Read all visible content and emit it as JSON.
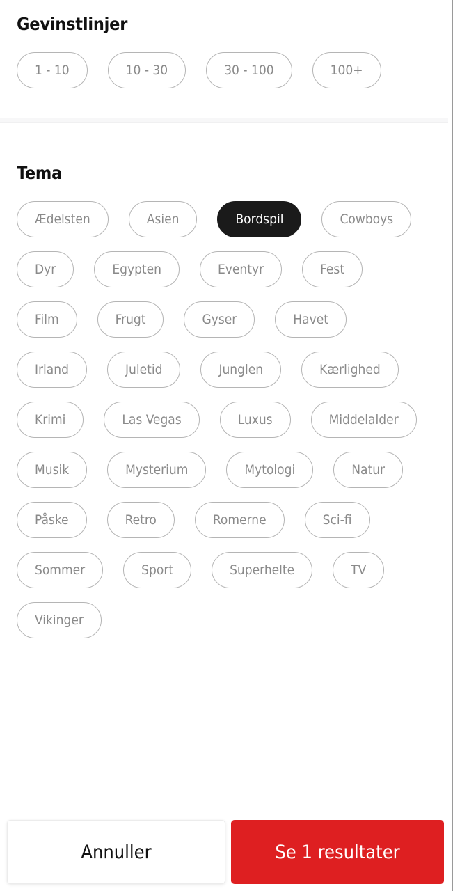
{
  "screen": {
    "name": "filter-panel",
    "accent_color": "#de1f21",
    "selected_chip_color": "#1a1a1a",
    "chip_border_color": "#b5b5b5",
    "chip_text_color": "#8a8a8a"
  },
  "sections": [
    {
      "id": "gevinstlinjer",
      "title": "Gevinstlinjer",
      "chips": [
        {
          "label": "1 - 10",
          "selected": false
        },
        {
          "label": "10 - 30",
          "selected": false
        },
        {
          "label": "30 - 100",
          "selected": false
        },
        {
          "label": "100+",
          "selected": false
        }
      ]
    },
    {
      "id": "tema",
      "title": "Tema",
      "chips": [
        {
          "label": "Ædelsten",
          "selected": false
        },
        {
          "label": "Asien",
          "selected": false
        },
        {
          "label": "Bordspil",
          "selected": true
        },
        {
          "label": "Cowboys",
          "selected": false
        },
        {
          "label": "Dyr",
          "selected": false
        },
        {
          "label": "Egypten",
          "selected": false
        },
        {
          "label": "Eventyr",
          "selected": false
        },
        {
          "label": "Fest",
          "selected": false
        },
        {
          "label": "Film",
          "selected": false
        },
        {
          "label": "Frugt",
          "selected": false
        },
        {
          "label": "Gyser",
          "selected": false
        },
        {
          "label": "Havet",
          "selected": false
        },
        {
          "label": "Irland",
          "selected": false
        },
        {
          "label": "Juletid",
          "selected": false
        },
        {
          "label": "Junglen",
          "selected": false
        },
        {
          "label": "Kærlighed",
          "selected": false
        },
        {
          "label": "Krimi",
          "selected": false
        },
        {
          "label": "Las Vegas",
          "selected": false
        },
        {
          "label": "Luxus",
          "selected": false
        },
        {
          "label": "Middelalder",
          "selected": false
        },
        {
          "label": "Musik",
          "selected": false
        },
        {
          "label": "Mysterium",
          "selected": false
        },
        {
          "label": "Mytologi",
          "selected": false
        },
        {
          "label": "Natur",
          "selected": false
        },
        {
          "label": "Påske",
          "selected": false
        },
        {
          "label": "Retro",
          "selected": false
        },
        {
          "label": "Romerne",
          "selected": false
        },
        {
          "label": "Sci-fi",
          "selected": false
        },
        {
          "label": "Sommer",
          "selected": false
        },
        {
          "label": "Sport",
          "selected": false
        },
        {
          "label": "Superhelte",
          "selected": false
        },
        {
          "label": "TV",
          "selected": false
        },
        {
          "label": "Vikinger",
          "selected": false
        }
      ]
    }
  ],
  "action_bar": {
    "cancel_label": "Annuller",
    "submit_label": "Se 1 resultater"
  }
}
